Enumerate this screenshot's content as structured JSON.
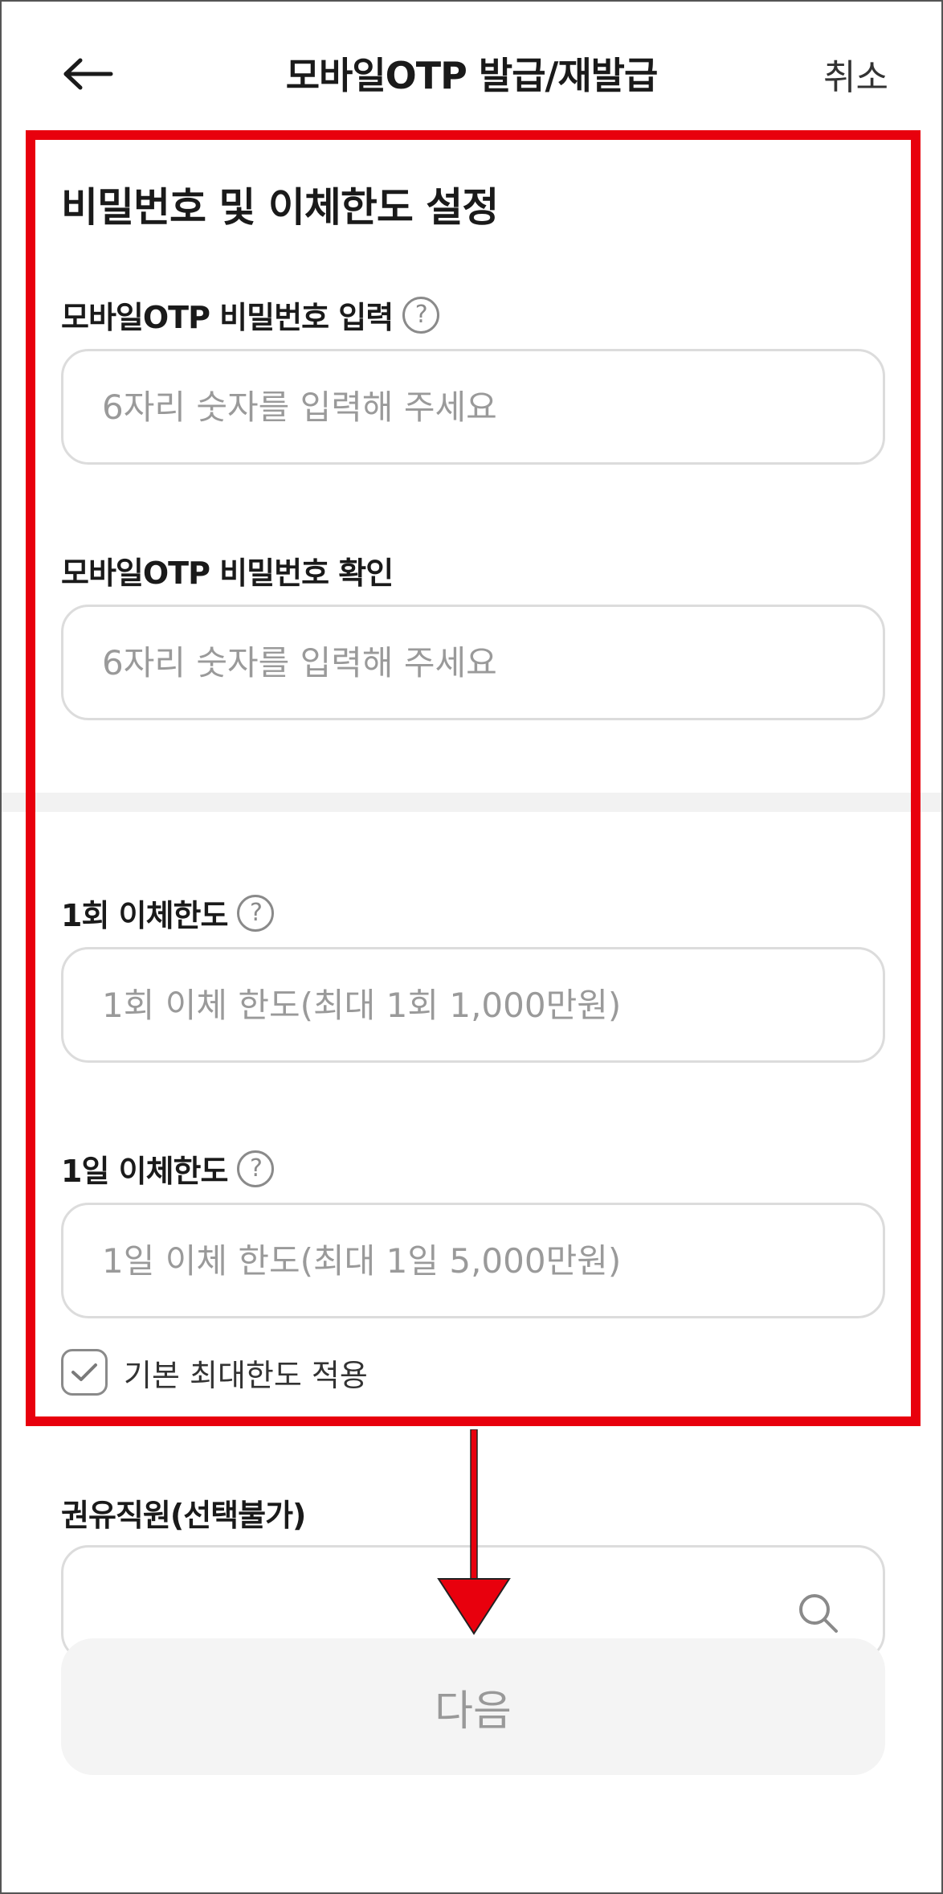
{
  "header": {
    "title": "모바일OTP 발급/재발급",
    "cancel_label": "취소"
  },
  "section": {
    "title": "비밀번호 및 이체한도 설정"
  },
  "fields": {
    "otp_password": {
      "label": "모바일OTP 비밀번호 입력",
      "placeholder": "6자리 숫자를 입력해 주세요"
    },
    "otp_password_confirm": {
      "label": "모바일OTP 비밀번호 확인",
      "placeholder": "6자리 숫자를 입력해 주세요"
    },
    "single_limit": {
      "label": "1회 이체한도",
      "placeholder": "1회 이체 한도(최대 1회 1,000만원)"
    },
    "daily_limit": {
      "label": "1일 이체한도",
      "placeholder": "1일 이체 한도(최대 1일 5,000만원)"
    }
  },
  "checkbox": {
    "label": "기본 최대한도 적용",
    "checked": true
  },
  "recommender": {
    "label": "권유직원(선택불가)"
  },
  "next_button": {
    "label": "다음"
  },
  "colors": {
    "highlight": "#e8000d",
    "border": "#dcdcdc",
    "placeholder": "#9a9a9a",
    "button_bg": "#f4f4f4"
  }
}
